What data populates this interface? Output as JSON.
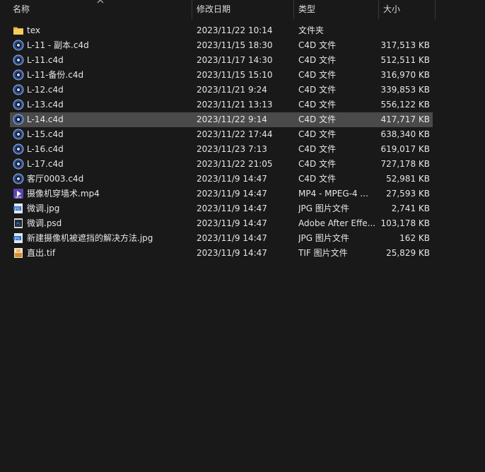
{
  "header": {
    "name": "名称",
    "date": "修改日期",
    "type": "类型",
    "size": "大小"
  },
  "rows": [
    {
      "name": "tex",
      "date": "2023/11/22 10:14",
      "type": "文件夹",
      "size": "",
      "icon": "folder-icon"
    },
    {
      "name": "L-11 - 副本.c4d",
      "date": "2023/11/15 18:30",
      "type": "C4D 文件",
      "size": "317,513 KB",
      "icon": "c4d-file-icon"
    },
    {
      "name": "L-11.c4d",
      "date": "2023/11/17 14:30",
      "type": "C4D 文件",
      "size": "512,511 KB",
      "icon": "c4d-file-icon"
    },
    {
      "name": "L-11-备份.c4d",
      "date": "2023/11/15 15:10",
      "type": "C4D 文件",
      "size": "316,970 KB",
      "icon": "c4d-file-icon"
    },
    {
      "name": "L-12.c4d",
      "date": "2023/11/21 9:24",
      "type": "C4D 文件",
      "size": "339,853 KB",
      "icon": "c4d-file-icon"
    },
    {
      "name": "L-13.c4d",
      "date": "2023/11/21 13:13",
      "type": "C4D 文件",
      "size": "556,122 KB",
      "icon": "c4d-file-icon"
    },
    {
      "name": "L-14.c4d",
      "date": "2023/11/22 9:14",
      "type": "C4D 文件",
      "size": "417,717 KB",
      "icon": "c4d-file-icon",
      "selected": true
    },
    {
      "name": "L-15.c4d",
      "date": "2023/11/22 17:44",
      "type": "C4D 文件",
      "size": "638,340 KB",
      "icon": "c4d-file-icon"
    },
    {
      "name": "L-16.c4d",
      "date": "2023/11/23 7:13",
      "type": "C4D 文件",
      "size": "619,017 KB",
      "icon": "c4d-file-icon"
    },
    {
      "name": "L-17.c4d",
      "date": "2023/11/22 21:05",
      "type": "C4D 文件",
      "size": "727,178 KB",
      "icon": "c4d-file-icon"
    },
    {
      "name": "客厅0003.c4d",
      "date": "2023/11/9 14:47",
      "type": "C4D 文件",
      "size": "52,981 KB",
      "icon": "c4d-file-icon"
    },
    {
      "name": "摄像机穿墙术.mp4",
      "date": "2023/11/9 14:47",
      "type": "MP4 - MPEG-4 ...",
      "size": "27,593 KB",
      "icon": "mp4-file-icon"
    },
    {
      "name": "微调.jpg",
      "date": "2023/11/9 14:47",
      "type": "JPG 图片文件",
      "size": "2,741 KB",
      "icon": "jpg-file-icon"
    },
    {
      "name": "微调.psd",
      "date": "2023/11/9 14:47",
      "type": "Adobe After Effe...",
      "size": "103,178 KB",
      "icon": "psd-file-icon"
    },
    {
      "name": "新建摄像机被遮挡的解决方法.jpg",
      "date": "2023/11/9 14:47",
      "type": "JPG 图片文件",
      "size": "162 KB",
      "icon": "jpg-file-icon"
    },
    {
      "name": "直出.tif",
      "date": "2023/11/9 14:47",
      "type": "TIF 图片文件",
      "size": "25,829 KB",
      "icon": "tif-file-icon"
    }
  ],
  "colors": {
    "background": "#191919",
    "selected_row": "#4a4a4a",
    "folder": "#f3c04c",
    "c4d": "#3a5fa8",
    "mp4": "#6b4fc7",
    "jpg": "#3c7bd1",
    "psd": "#2c3e50"
  }
}
